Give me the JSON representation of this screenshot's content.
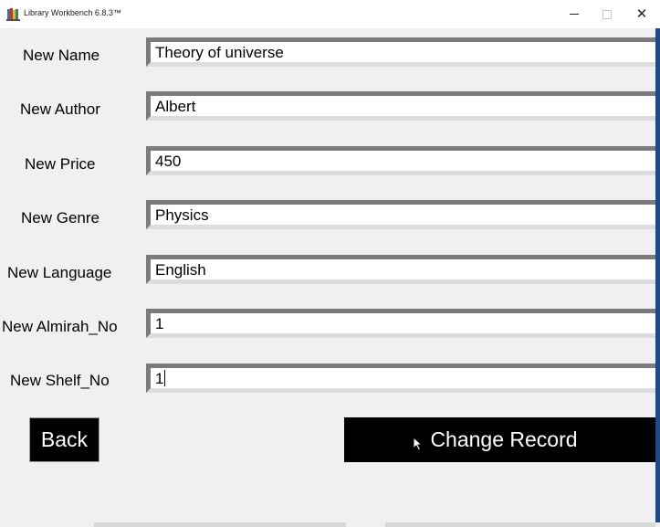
{
  "window": {
    "title": "Library Workbench 6.8.3™",
    "icon": "library-books-icon",
    "controls": {
      "minimize": "minimize-icon",
      "maximize": "maximize-icon",
      "close": "close-icon"
    }
  },
  "form": {
    "fields": [
      {
        "label": "New Name",
        "value": "Theory of universe"
      },
      {
        "label": "New Author",
        "value": "Albert"
      },
      {
        "label": "New Price",
        "value": "450"
      },
      {
        "label": "New Genre",
        "value": "Physics"
      },
      {
        "label": "New Language",
        "value": "English"
      },
      {
        "label": "New Almirah_No",
        "value": "1"
      },
      {
        "label": "New Shelf_No",
        "value": "1"
      }
    ],
    "focused_field": "New Shelf_No"
  },
  "buttons": {
    "back_label": "Back",
    "change_record_label": "Change Record"
  },
  "colors": {
    "button_bg": "#000000",
    "button_text": "#ffffff",
    "window_bg": "#f0f0f0",
    "desktop_edge": "#1f4a86"
  }
}
